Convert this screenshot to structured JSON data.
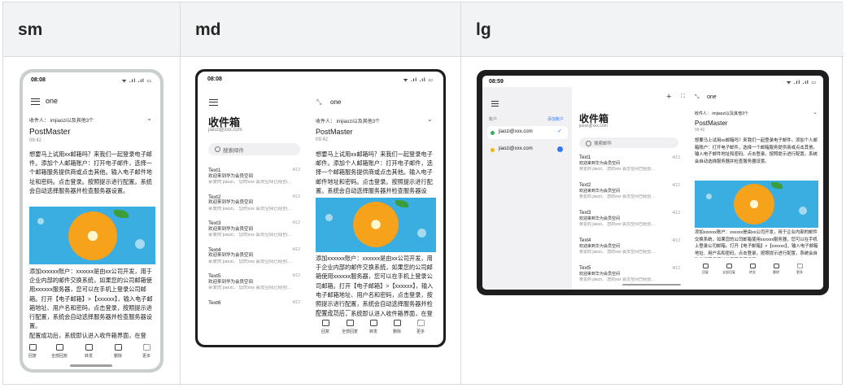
{
  "headers": [
    "sm",
    "md",
    "lg"
  ],
  "status": {
    "time_sm": "08:08",
    "time_md": "08:08",
    "time_lg": "08:59",
    "icons": "ᯤ .ıl .ıl ▭"
  },
  "mail": {
    "folder": "one",
    "to_label": "收件人：",
    "to_value": "imjiaozi以及其他3个",
    "sender": "PostMaster",
    "time": "09:42",
    "body1": "想要马上试用xx邮箱吗？来我们一起登录电子邮件。添加个人邮箱账户：打开电子邮件，选择一个邮箱服务提供商或点击其他。输入电子邮件地址和密码。点击登录。按照提示进行配置。系统会自动选择服务器并检查服务器设置。",
    "body2": "添加xxxxxx账户：xxxxxx是由xx公司开发，用于企业内部的邮件交换系统，如果您的公司邮箱使用xxxxxx服务器，您可以在手机上登录公司邮箱。打开【电子邮箱】>【xxxxxx】，输入电子邮箱地址、用户名和密码，点击登录，按照提示进行配置，系统会自动选择服务器并检查服务器设置。",
    "body3": "配置成功后，系统即认进入收件箱界面，在登"
  },
  "inbox": {
    "title": "收件箱",
    "account": "jiaozi@xxx.com",
    "search_placeholder": "搜索邮件",
    "items": [
      {
        "name": "Text1",
        "subject": "欢迎来到华为会员空间",
        "preview": "亲爱的 jiaozi，  您的xxx 会员空间已经创…",
        "date": "4/12"
      },
      {
        "name": "Text2",
        "subject": "欢迎来到华为会员空间",
        "preview": "亲爱的 jiaozi，  您的xxx 会员空间已经创…",
        "date": "4/12"
      },
      {
        "name": "Text3",
        "subject": "欢迎来到华为会员空间",
        "preview": "亲爱的 jiaozi，  您的xxx 会员空间已经创…",
        "date": "4/12"
      },
      {
        "name": "Text4",
        "subject": "欢迎来到华为会员空间",
        "preview": "亲爱的 jiaozi，  您的xxx 会员空间已经创…",
        "date": "4/12"
      },
      {
        "name": "Text5",
        "subject": "欢迎来到华为会员空间",
        "preview": "亲爱的 jiaozi，  您的xxx 会员空间已经创…",
        "date": "4/12"
      },
      {
        "name": "Text6",
        "subject": "",
        "preview": "",
        "date": "4/12"
      }
    ]
  },
  "accounts": {
    "label": "账户",
    "add": "添加账户",
    "list": [
      {
        "email": "jiaozi@xxx.com",
        "color": "#2fb35a"
      },
      {
        "email": "jiaozi@xxx.com",
        "color": "#f5b400"
      }
    ]
  },
  "toolbar": [
    "回复",
    "全部回复",
    "转发",
    "删除",
    "更多"
  ]
}
